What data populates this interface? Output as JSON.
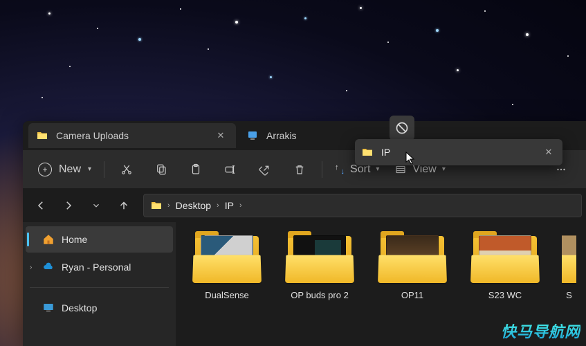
{
  "tabs": [
    {
      "label": "Camera Uploads",
      "icon": "folder-icon"
    },
    {
      "label": "Arrakis",
      "icon": "pc-icon"
    }
  ],
  "dragged_tab": {
    "label": "IP",
    "icon": "folder-icon"
  },
  "toolbar": {
    "new_label": "New",
    "sort_label": "Sort",
    "view_label": "View"
  },
  "breadcrumbs": [
    "Desktop",
    "IP"
  ],
  "sidebar": {
    "items": [
      {
        "label": "Home",
        "icon": "home-icon",
        "active": true
      },
      {
        "label": "Ryan - Personal",
        "icon": "onedrive-icon",
        "expandable": true
      }
    ],
    "section2": [
      {
        "label": "Desktop",
        "icon": "desktop-icon"
      }
    ]
  },
  "folders": [
    {
      "label": "DualSense"
    },
    {
      "label": "OP buds pro 2"
    },
    {
      "label": "OP11"
    },
    {
      "label": "S23 WC"
    },
    {
      "label": "S"
    }
  ],
  "watermark": "快马导航网"
}
